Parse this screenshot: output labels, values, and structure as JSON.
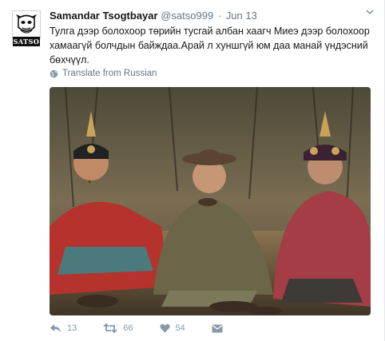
{
  "avatar": {
    "badge_text": "SATSO"
  },
  "tweet": {
    "author_name": "Samandar Tsogtbayar",
    "handle": "@satso999",
    "separator": "·",
    "time": "Jun 13",
    "text_lines": [
      "Тулга дээр болохоор төрийн тусгай албан хаагч Миеэ дээр болохоор",
      "хамаагүй болчдын байждаа.Арай л хуншгүй юм даа манай үндэсний",
      "бөхчүүл."
    ],
    "translate_label": "Translate from Russian"
  },
  "actions": {
    "reply_count": "13",
    "retweet_count": "66",
    "like_count": "54"
  },
  "colors": {
    "text": "#14171a",
    "muted": "#657786",
    "icon": "#8899a6"
  }
}
